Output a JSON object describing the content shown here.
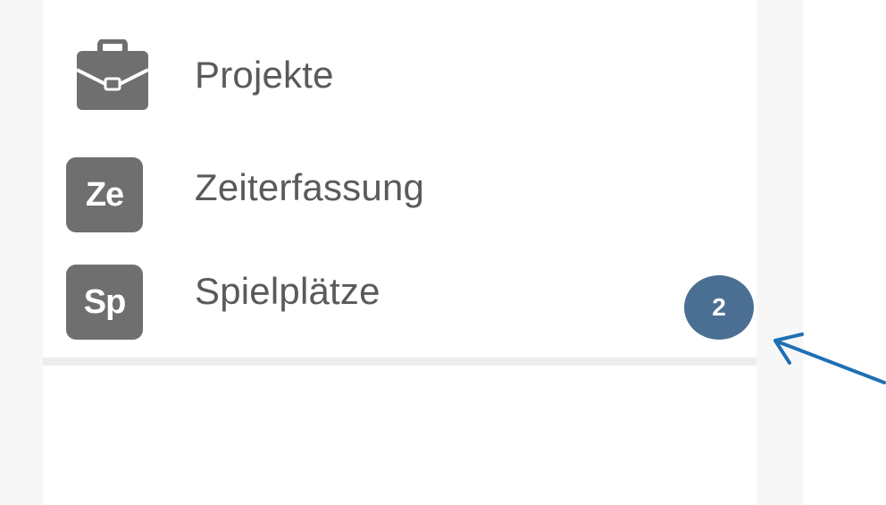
{
  "menu": {
    "items": [
      {
        "label": "Projekte",
        "icon": "briefcase-icon"
      },
      {
        "label": "Zeiterfassung",
        "icon_text": "Ze"
      },
      {
        "label": "Spielplätze",
        "icon_text": "Sp",
        "count": "2"
      }
    ]
  },
  "colors": {
    "icon_gray": "#6f6f6f",
    "badge_blue": "#4a6f92",
    "arrow_blue": "#1f6fb3",
    "label_text": "#5a5a5a"
  }
}
